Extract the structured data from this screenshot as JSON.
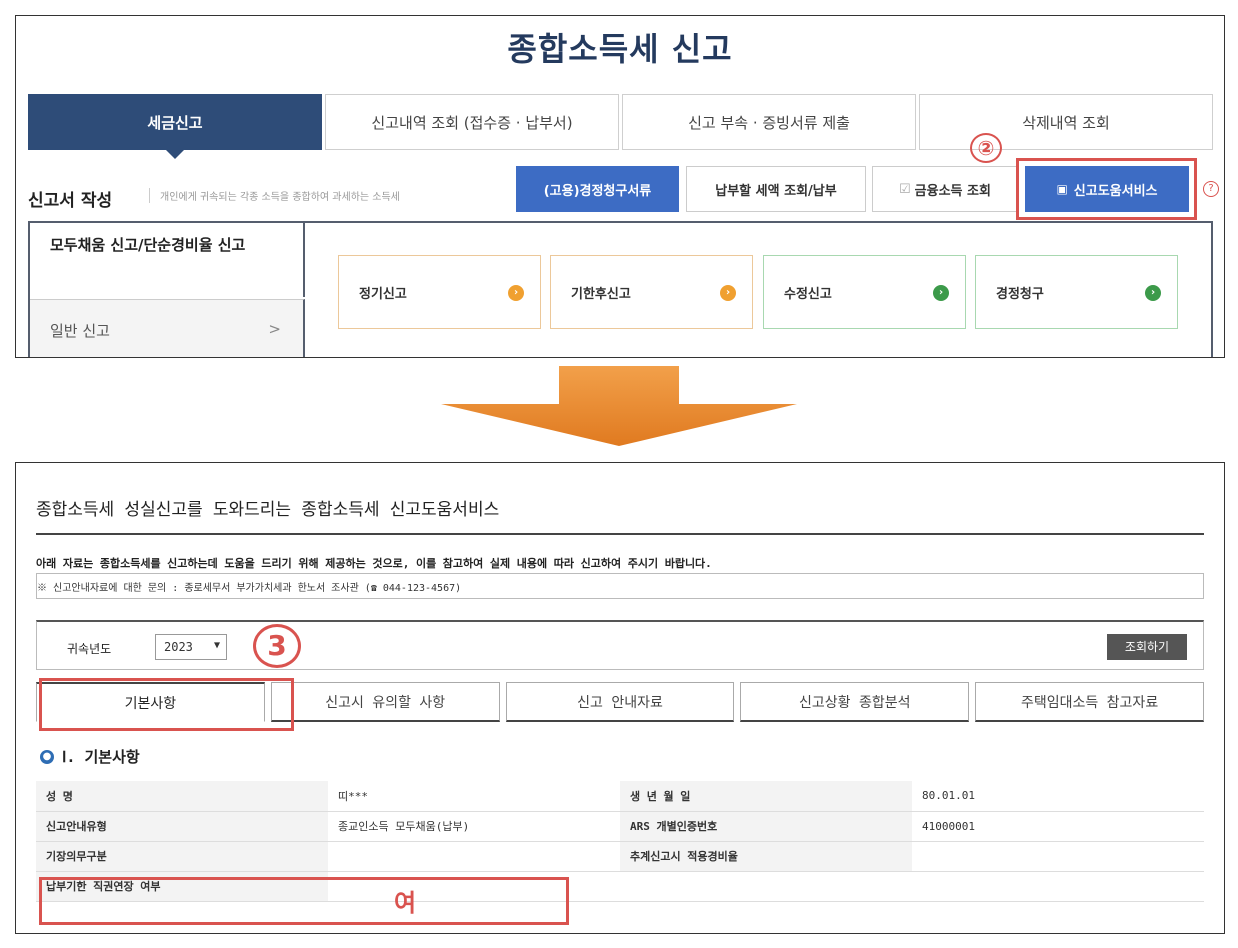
{
  "top": {
    "title": "종합소득세 신고",
    "tabs": [
      {
        "label": "세금신고",
        "active": true
      },
      {
        "label": "신고내역 조회 (접수증 · 납부서)",
        "active": false
      },
      {
        "label": "신고 부속 · 증빙서류 제출",
        "active": false
      },
      {
        "label": "삭제내역 조회",
        "active": false
      }
    ],
    "section_title": "신고서 작성",
    "section_desc": "개인에게 귀속되는 각종 소득을 종합하여 과세하는 소득세",
    "buttons": {
      "amend": "(고용)경정청구서류",
      "pay": "납부할 세액 조회/납부",
      "fin_icon": "checkbox-icon",
      "fin": "금융소득 조회",
      "help_icon": "book-icon",
      "help": "신고도움서비스"
    },
    "callout2": "②",
    "help_q": "?",
    "side": {
      "active": "모두채움 신고/단순경비율 신고",
      "normal": "일반 신고",
      "chev": ">"
    },
    "cards": [
      {
        "label": "정기신고",
        "color": "#f0a030"
      },
      {
        "label": "기한후신고",
        "color": "#f0a030"
      },
      {
        "label": "수정신고",
        "color": "#3c9a4a"
      },
      {
        "label": "경정청구",
        "color": "#3c9a4a"
      }
    ]
  },
  "bottom": {
    "title": "종합소득세 성실신고를 도와드리는 종합소득세 신고도움서비스",
    "notice": "아래 자료는 종합소득세를 신고하는데 도움을 드리기 위해 제공하는 것으로, 이를 참고하여 실제 내용에 따라 신고하여 주시기 바랍니다.",
    "contact": "※ 신고안내자료에 대한 문의 : 종로세무서 부가가치세과 한노서 조사관 (☎ 044-123-4567)",
    "year_label": "귀속년도",
    "year_value": "2023",
    "callout3": "3",
    "search_btn": "조회하기",
    "tabs": [
      "기본사항",
      "신고시 유의할 사항",
      "신고 안내자료",
      "신고상황 종합분석",
      "주택임대소득 참고자료"
    ],
    "section_head": "Ⅰ. 기본사항",
    "rows": [
      {
        "l1": "성          명",
        "v1": "띠***",
        "l2": "생  년  월  일",
        "v2": "80.01.01"
      },
      {
        "l1": "신고안내유형",
        "v1": "종교인소득 모두채움(납부)",
        "l2": "ARS 개별인증번호",
        "v2": "41000001"
      },
      {
        "l1": "기장의무구분",
        "v1": "",
        "l2": "추계신고시 적용경비율",
        "v2": ""
      },
      {
        "l1": "납부기한 직권연장 여부",
        "v1": "여",
        "l2": "",
        "v2": ""
      }
    ]
  }
}
